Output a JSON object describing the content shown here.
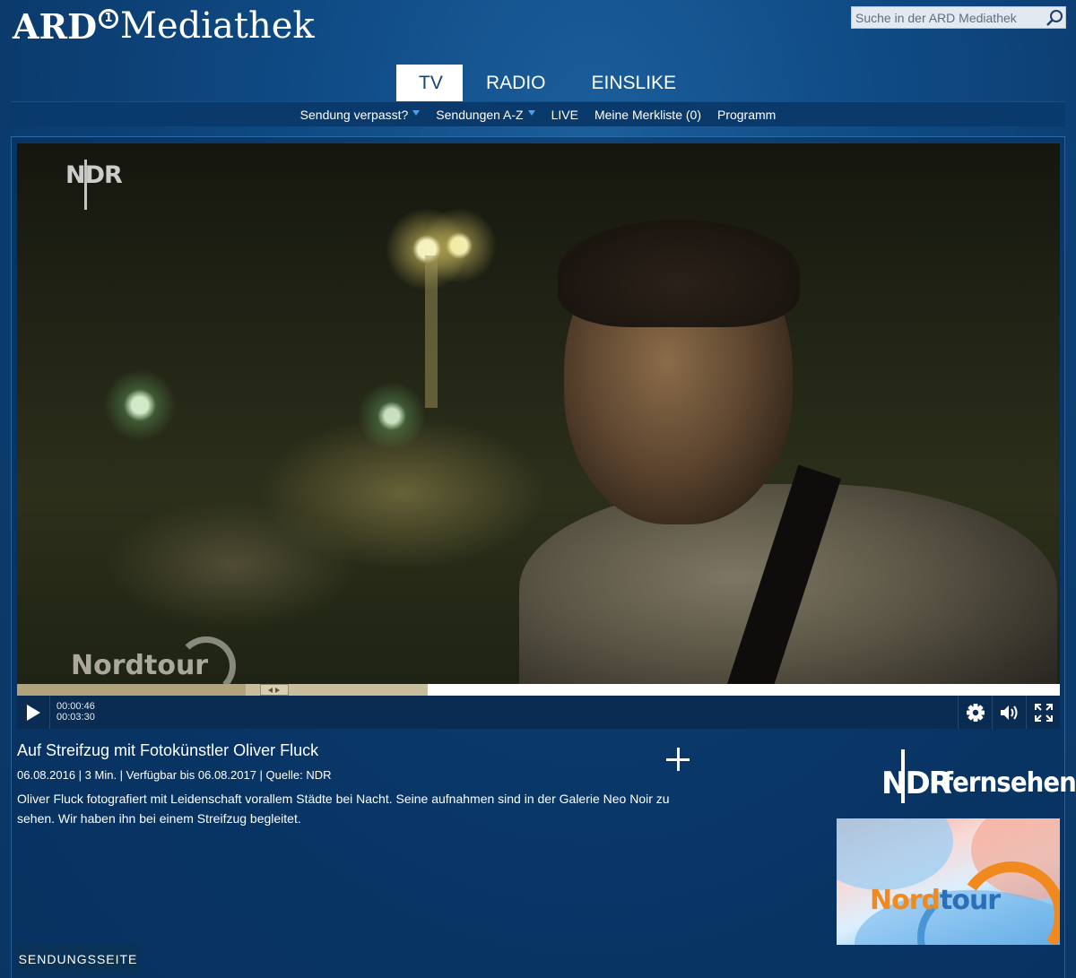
{
  "header": {
    "logo_ard": "ARD",
    "logo_one": "1",
    "logo_mediathek": "Mediathek",
    "search_placeholder": "Suche in der ARD Mediathek",
    "search_icon": "search-icon"
  },
  "tabs": [
    {
      "label": "TV",
      "active": true
    },
    {
      "label": "RADIO",
      "active": false
    },
    {
      "label": "EINSLIKE",
      "active": false
    }
  ],
  "subnav": [
    {
      "label": "Sendung verpasst?",
      "dropdown": true
    },
    {
      "label": "Sendungen A-Z",
      "dropdown": true
    },
    {
      "label": "LIVE",
      "dropdown": false
    },
    {
      "label": "Meine Merkliste (0)",
      "dropdown": false
    },
    {
      "label": "Programm",
      "dropdown": false
    }
  ],
  "video": {
    "channel_watermark": "NDR",
    "show_watermark": "Nordtour",
    "current_time": "00:00:46",
    "duration": "00:03:30",
    "played_fraction": 0.219,
    "buffered_fraction": 0.394
  },
  "info": {
    "title": "Auf Streifzug mit Fotokünstler Oliver Fluck",
    "meta": "06.08.2016 | 3 Min. | Verfügbar bis 06.08.2017 | Quelle: NDR",
    "description": "Oliver Fluck fotografiert mit Leidenschaft vorallem Städte bei Nacht. Seine aufnahmen sind in der Galerie Neo Noir zu sehen. Wir haben ihn bei einem Streifzug begleitet."
  },
  "sidebar": {
    "channel_logo_ndr": "NDR",
    "channel_logo_fernsehen": "fernsehen",
    "show_thumb_label_a": "Nord",
    "show_thumb_label_b": "tour"
  },
  "buttons": {
    "sendungsseite": "SENDUNGSSEITE"
  },
  "colors": {
    "background": "#0f4a84",
    "accent_caret": "#4aa3ea",
    "progress_played": "#b2a37c",
    "nordtour_orange": "#f08a1e"
  }
}
